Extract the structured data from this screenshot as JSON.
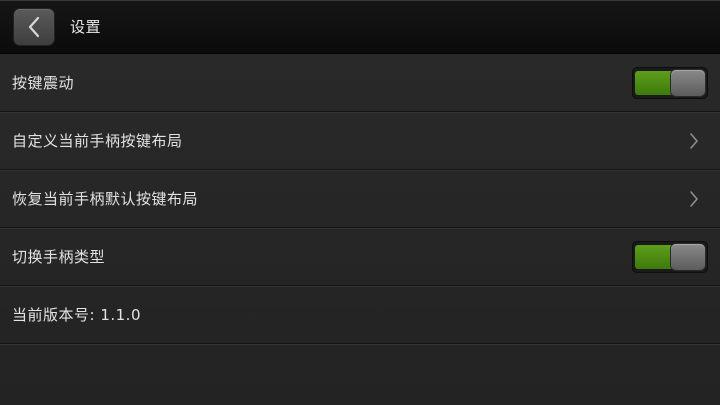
{
  "header": {
    "title": "设置"
  },
  "rows": [
    {
      "label": "按键震动",
      "control": "toggle",
      "state": "on"
    },
    {
      "label": "自定义当前手柄按键布局",
      "control": "chevron"
    },
    {
      "label": "恢复当前手柄默认按键布局",
      "control": "chevron"
    },
    {
      "label": "切换手柄类型",
      "control": "toggle",
      "state": "on"
    },
    {
      "label": "当前版本号: 1.1.0",
      "control": "none"
    }
  ],
  "icons": {
    "back": "chevron-left-icon",
    "row_arrow": "chevron-right-icon"
  },
  "colors": {
    "toggle_on": "#4f8f16",
    "background": "#262626",
    "titlebar": "#111111"
  }
}
